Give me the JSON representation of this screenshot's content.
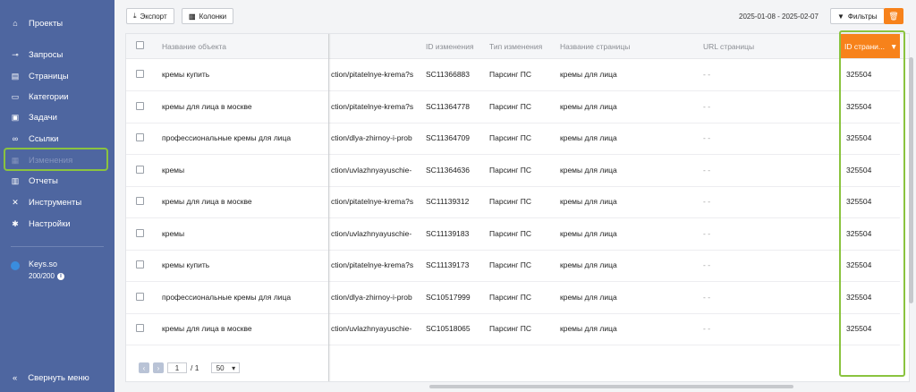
{
  "sidebar": {
    "items": [
      {
        "label": "Проекты",
        "icon": "home-icon"
      },
      {
        "label": "Запросы",
        "icon": "key-icon"
      },
      {
        "label": "Страницы",
        "icon": "pages-icon"
      },
      {
        "label": "Категории",
        "icon": "folder-icon"
      },
      {
        "label": "Задачи",
        "icon": "task-icon"
      },
      {
        "label": "Ссылки",
        "icon": "link-icon"
      },
      {
        "label": "Изменения",
        "icon": "changes-icon"
      },
      {
        "label": "Отчеты",
        "icon": "reports-icon"
      },
      {
        "label": "Инструменты",
        "icon": "tools-icon"
      },
      {
        "label": "Настройки",
        "icon": "gear-icon"
      }
    ],
    "keys_name": "Keys.so",
    "keys_quota": "200/200",
    "collapse_label": "Свернуть меню"
  },
  "toolbar": {
    "export_label": "Экспорт",
    "columns_label": "Колонки",
    "date_range": "2025-01-08 - 2025-02-07",
    "filters_label": "Фильтры"
  },
  "table": {
    "headers": {
      "object_name": "Название объекта",
      "change_id": "ID изменения",
      "change_type": "Тип изменения",
      "page_name": "Название страницы",
      "page_url": "URL страницы",
      "page_id": "ID страни..."
    },
    "rows": [
      {
        "object": "кремы купить",
        "url": "ction/pitatelnye-krema?s",
        "change_id": "SC11366883",
        "type": "Парсинг ПС",
        "page_name": "кремы для лица",
        "page_url": "- -",
        "page_id": "325504"
      },
      {
        "object": "кремы для лица в москве",
        "url": "ction/pitatelnye-krema?s",
        "change_id": "SC11364778",
        "type": "Парсинг ПС",
        "page_name": "кремы для лица",
        "page_url": "- -",
        "page_id": "325504"
      },
      {
        "object": "профессиональные кремы для лица",
        "url": "ction/dlya-zhirnoy-i-prob",
        "change_id": "SC11364709",
        "type": "Парсинг ПС",
        "page_name": "кремы для лица",
        "page_url": "- -",
        "page_id": "325504"
      },
      {
        "object": "кремы",
        "url": "ction/uvlazhnyayuschie-",
        "change_id": "SC11364636",
        "type": "Парсинг ПС",
        "page_name": "кремы для лица",
        "page_url": "- -",
        "page_id": "325504"
      },
      {
        "object": "кремы для лица в москве",
        "url": "ction/pitatelnye-krema?s",
        "change_id": "SC11139312",
        "type": "Парсинг ПС",
        "page_name": "кремы для лица",
        "page_url": "- -",
        "page_id": "325504"
      },
      {
        "object": "кремы",
        "url": "ction/uvlazhnyayuschie-",
        "change_id": "SC11139183",
        "type": "Парсинг ПС",
        "page_name": "кремы для лица",
        "page_url": "- -",
        "page_id": "325504"
      },
      {
        "object": "кремы купить",
        "url": "ction/pitatelnye-krema?s",
        "change_id": "SC11139173",
        "type": "Парсинг ПС",
        "page_name": "кремы для лица",
        "page_url": "- -",
        "page_id": "325504"
      },
      {
        "object": "профессиональные кремы для лица",
        "url": "ction/dlya-zhirnoy-i-prob",
        "change_id": "SC10517999",
        "type": "Парсинг ПС",
        "page_name": "кремы для лица",
        "page_url": "- -",
        "page_id": "325504"
      },
      {
        "object": "кремы для лица в москве",
        "url": "ction/uvlazhnyayuschie-",
        "change_id": "SC10518065",
        "type": "Парсинг ПС",
        "page_name": "кремы для лица",
        "page_url": "- -",
        "page_id": "325504"
      }
    ]
  },
  "pager": {
    "current_page": "1",
    "total_pages": "/ 1",
    "page_size": "50"
  },
  "colors": {
    "sidebar": "#4e66a0",
    "accent": "#f7821b",
    "highlight": "#8ac33f"
  }
}
